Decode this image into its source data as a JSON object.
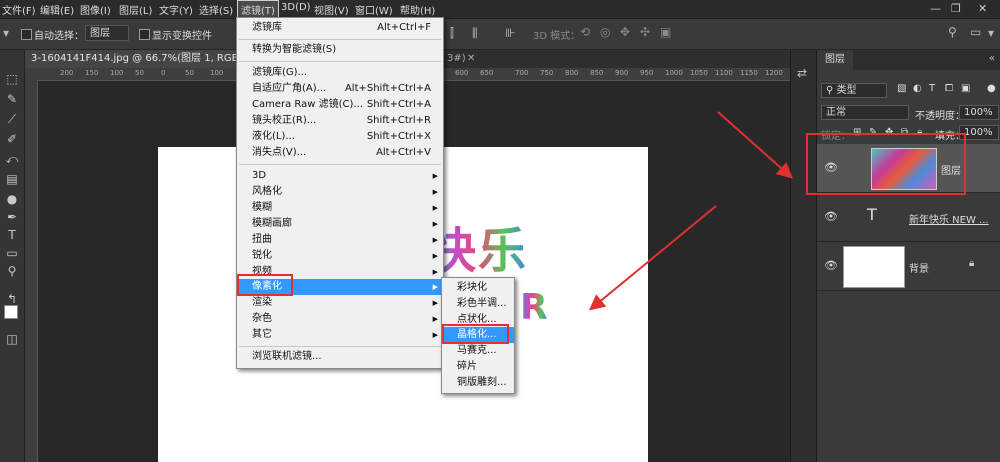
{
  "menubar": {
    "items": [
      "文件(F)",
      "编辑(E)",
      "图像(I)",
      "图层(L)",
      "文字(Y)",
      "选择(S)",
      "滤镜(T)",
      "3D(D)",
      "视图(V)",
      "窗口(W)",
      "帮助(H)"
    ]
  },
  "optionsbar": {
    "auto_select_label": "自动选择：",
    "auto_select_value": "图层",
    "show_transform_label": "显示变换控件",
    "mode_3d_label": "3D 模式："
  },
  "document": {
    "tab_title": "3-1604141F414.jpg @ 66.7%(图层 1, RGB/8#) *",
    "tab_suffix": "3#)",
    "ruler_numbers": [
      "200",
      "150",
      "100",
      "50",
      "0",
      "50",
      "100",
      "150",
      "200",
      "250",
      "300",
      "350",
      "400",
      "450",
      "500",
      "550",
      "600",
      "650",
      "700",
      "750",
      "800",
      "850",
      "900",
      "950",
      "1000",
      "1050",
      "1100",
      "1150",
      "1200"
    ],
    "art_line1": "快乐",
    "art_line2": "R"
  },
  "filter_menu": {
    "items": [
      {
        "label": "滤镜库",
        "shortcut": "Alt+Ctrl+F"
      },
      {
        "label": "转换为智能滤镜(S)",
        "shortcut": ""
      },
      {
        "label": "滤镜库(G)...",
        "shortcut": ""
      },
      {
        "label": "自适应广角(A)...",
        "shortcut": "Alt+Shift+Ctrl+A"
      },
      {
        "label": "Camera Raw 滤镜(C)...",
        "shortcut": "Shift+Ctrl+A"
      },
      {
        "label": "镜头校正(R)...",
        "shortcut": "Shift+Ctrl+R"
      },
      {
        "label": "液化(L)...",
        "shortcut": "Shift+Ctrl+X"
      },
      {
        "label": "消失点(V)...",
        "shortcut": "Alt+Ctrl+V"
      },
      {
        "label": "3D",
        "shortcut": ""
      },
      {
        "label": "风格化",
        "shortcut": ""
      },
      {
        "label": "模糊",
        "shortcut": ""
      },
      {
        "label": "模糊画廊",
        "shortcut": ""
      },
      {
        "label": "扭曲",
        "shortcut": ""
      },
      {
        "label": "锐化",
        "shortcut": ""
      },
      {
        "label": "视频",
        "shortcut": ""
      },
      {
        "label": "像素化",
        "shortcut": ""
      },
      {
        "label": "渲染",
        "shortcut": ""
      },
      {
        "label": "杂色",
        "shortcut": ""
      },
      {
        "label": "其它",
        "shortcut": ""
      },
      {
        "label": "浏览联机滤镜...",
        "shortcut": ""
      }
    ]
  },
  "pixelate_submenu": {
    "items": [
      "彩块化",
      "彩色半调...",
      "点状化...",
      "晶格化...",
      "马赛克...",
      "碎片",
      "铜版雕刻..."
    ]
  },
  "layers_panel": {
    "tab_label": "图层",
    "filter_kind": "类型",
    "blend_mode": "正常",
    "opacity_label": "不透明度：",
    "opacity_value": "100%",
    "lock_label": "锁定：",
    "fill_label": "填充：",
    "fill_value": "100%",
    "layers": [
      {
        "name": "图层",
        "type": "pixel"
      },
      {
        "name": "新年快乐 NEW ...",
        "type": "text"
      },
      {
        "name": "背景",
        "type": "background"
      }
    ]
  },
  "colors": {
    "highlight": "#3399ff",
    "annotation_red": "#e03030"
  }
}
